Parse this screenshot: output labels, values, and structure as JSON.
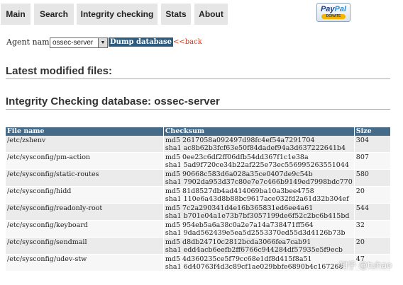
{
  "nav": {
    "tabs": [
      {
        "label": "Main"
      },
      {
        "label": "Search"
      },
      {
        "label": "Integrity checking"
      },
      {
        "label": "Stats"
      },
      {
        "label": "About"
      }
    ],
    "paypal": {
      "logo_pay": "Pay",
      "logo_pal": "Pal",
      "donate": "DONATE"
    }
  },
  "agent": {
    "label": "Agent name:",
    "selected": "ossec-server",
    "dump_label": "Dump database",
    "back_label": "<<back"
  },
  "sections": {
    "latest_title": "Latest modified files:",
    "integrity_title": "Integrity Checking database: ossec-server"
  },
  "table": {
    "headers": [
      "File name",
      "Checksum",
      "Size"
    ],
    "rows": [
      {
        "file": "/etc/zshenv",
        "md5": "md5 2617058a092497d98fc4ef54a7291704",
        "sha1": "sha1 ac8b62b3fcf63e50f84dadef94a3d637222641b4",
        "size": "304"
      },
      {
        "file": "/etc/sysconfig/pm-action",
        "md5": "md5 0ee23c6df2ff06dfb54dd367f1c1e38a",
        "sha1": "sha1 5ad9f720ce34b22af225e73ec556995263551044",
        "size": "807"
      },
      {
        "file": "/etc/sysconfig/static-routes",
        "md5": "md5 90668c583d6a028a35ce0407de9c54b",
        "sha1": "sha1 7902da953d37c80e7e7c466b9149ed7998bdc770",
        "size": "580"
      },
      {
        "file": "/etc/sysconfig/hidd",
        "md5": "md5 81d8527db4ad414069ba10a3bee4758",
        "sha1": "sha1 110e6a43d8b88bc9617ace032fd2a61d32b304ef",
        "size": "20"
      },
      {
        "file": "/etc/sysconfig/readonly-root",
        "md5": "md5 7c2a290341d4e16b365831ed6ee4a61",
        "sha1": "sha1 b701e04a1e73b7bf3057199de6f52c2bc6b415bd",
        "size": "544"
      },
      {
        "file": "/etc/sysconfig/keyboard",
        "md5": "md5 954eb5a6a38c0a2e7a14a738471ff564",
        "sha1": "sha1 9dad562439e5ea5d2553370ed55d3d4126b73b",
        "size": "32"
      },
      {
        "file": "/etc/sysconfig/sendmail",
        "md5": "md5 d8db24710c2812bcda3066fea7cab91",
        "sha1": "sha1 edd4acb6eefb2ff6766c944284df57935e5f9ecb",
        "size": "20"
      },
      {
        "file": "/etc/sysconfig/udev-stw",
        "md5": "md5 4d360235ce5f79cc68e1df8d415f8a51",
        "sha1": "sha1 6d40763f4d3c89cf1ae029bbfe6890b4c167268",
        "size": "47"
      }
    ]
  },
  "watermark": "知乎 @tuhao"
}
